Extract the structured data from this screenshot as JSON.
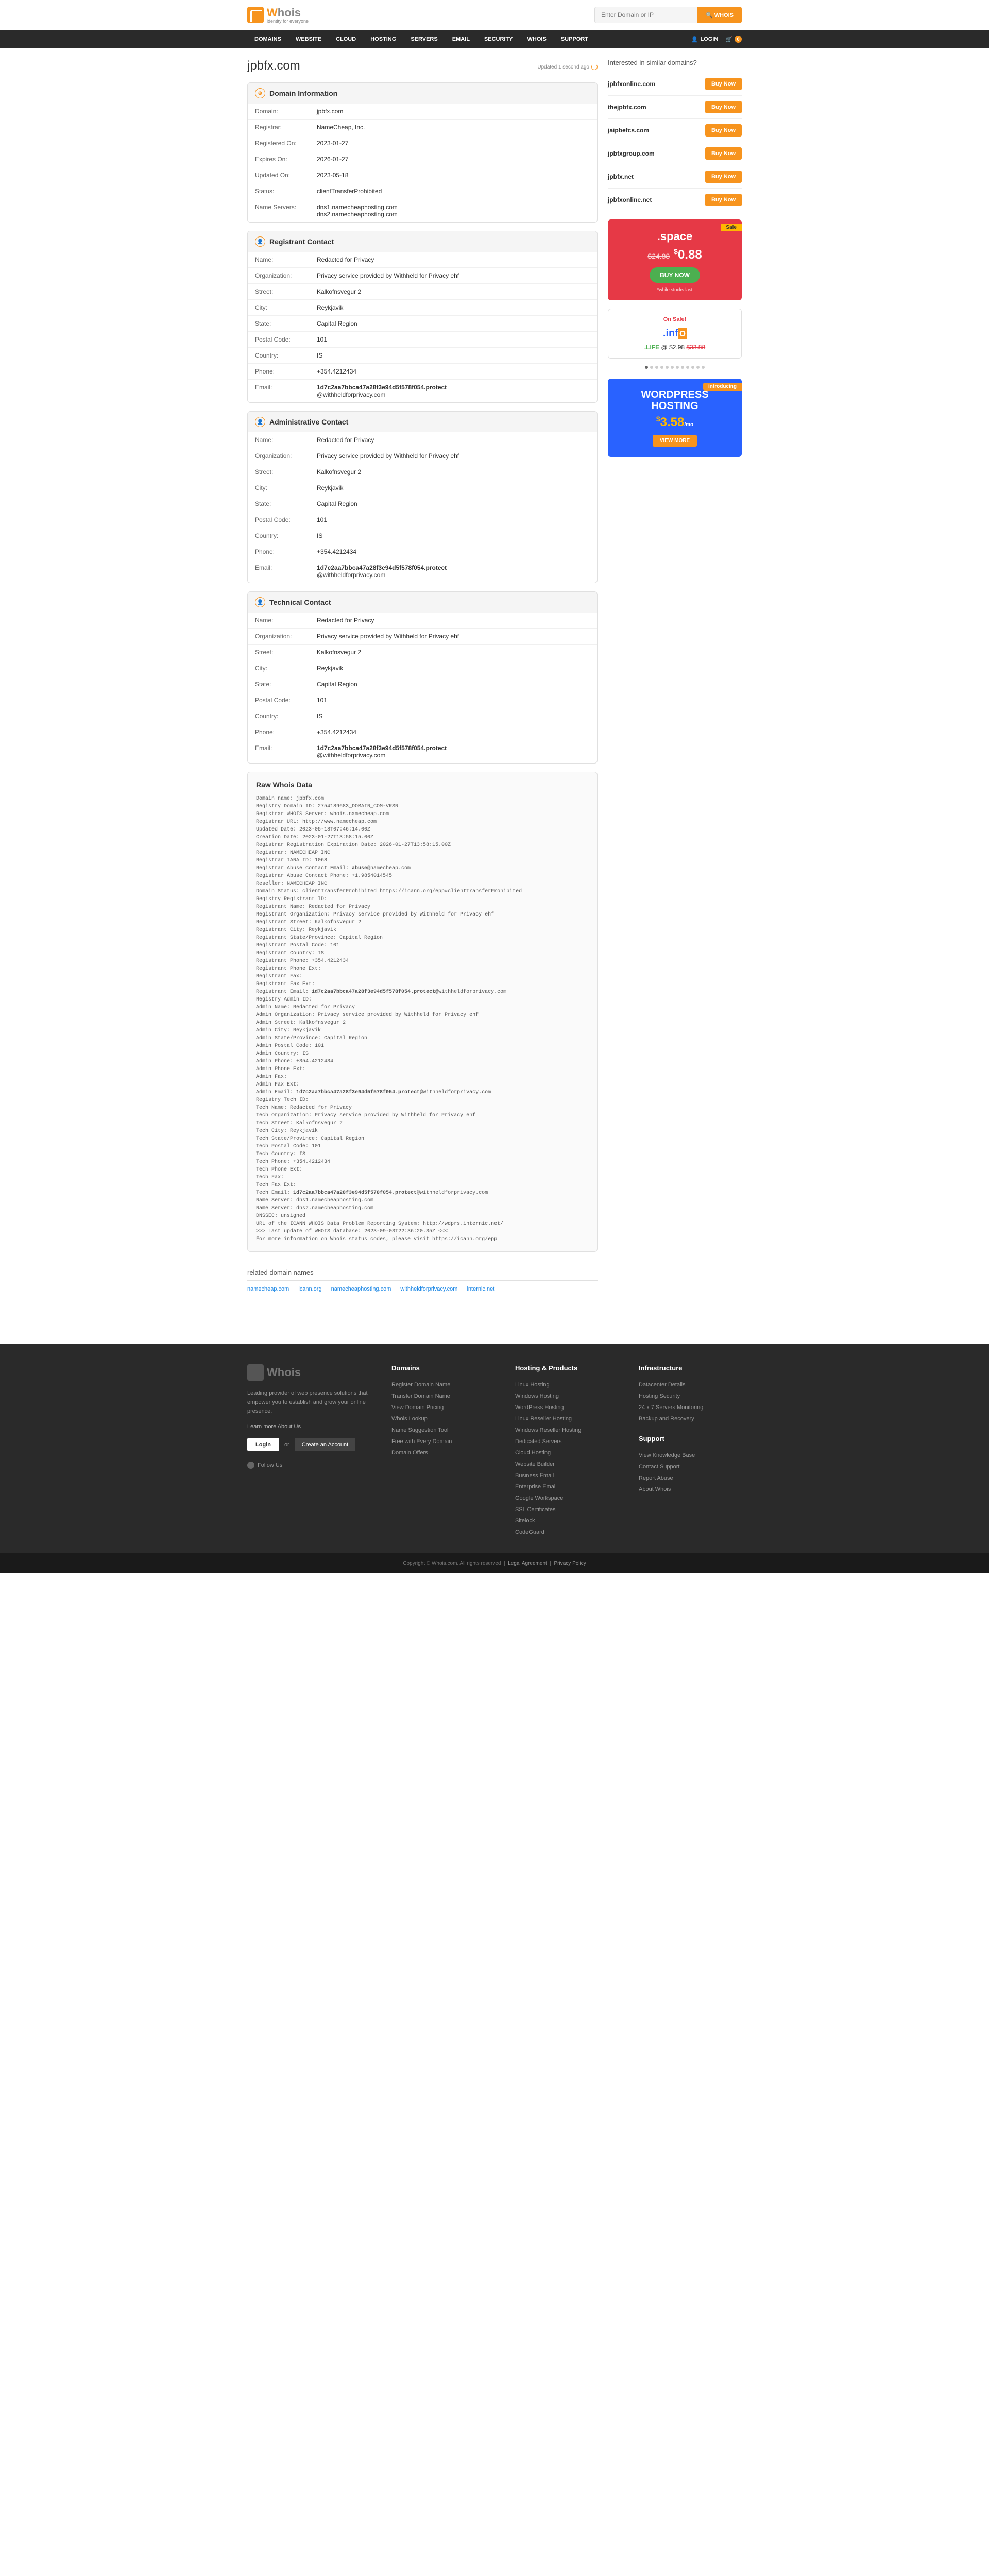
{
  "header": {
    "tagline": "identity for everyone",
    "search_placeholder": "Enter Domain or IP",
    "search_button": "WHOIS"
  },
  "nav": {
    "items": [
      "DOMAINS",
      "WEBSITE",
      "CLOUD",
      "HOSTING",
      "SERVERS",
      "EMAIL",
      "SECURITY",
      "WHOIS",
      "SUPPORT"
    ],
    "login": "LOGIN",
    "cart_count": "0"
  },
  "page": {
    "domain_title": "jpbfx.com",
    "updated_text": "Updated 1 second ago"
  },
  "domain_info": {
    "heading": "Domain Information",
    "rows": [
      {
        "label": "Domain:",
        "value": "jpbfx.com"
      },
      {
        "label": "Registrar:",
        "value": "NameCheap, Inc."
      },
      {
        "label": "Registered On:",
        "value": "2023-01-27"
      },
      {
        "label": "Expires On:",
        "value": "2026-01-27"
      },
      {
        "label": "Updated On:",
        "value": "2023-05-18"
      },
      {
        "label": "Status:",
        "value": "clientTransferProhibited"
      },
      {
        "label": "Name Servers:",
        "value": "dns1.namecheaphosting.com\ndns2.namecheaphosting.com"
      }
    ]
  },
  "registrant": {
    "heading": "Registrant Contact",
    "rows": [
      {
        "label": "Name:",
        "value": "Redacted for Privacy"
      },
      {
        "label": "Organization:",
        "value": "Privacy service provided by Withheld for Privacy ehf"
      },
      {
        "label": "Street:",
        "value": "Kalkofnsvegur 2"
      },
      {
        "label": "City:",
        "value": "Reykjavik"
      },
      {
        "label": "State:",
        "value": "Capital Region"
      },
      {
        "label": "Postal Code:",
        "value": "101"
      },
      {
        "label": "Country:",
        "value": "IS"
      },
      {
        "label": "Phone:",
        "value": "+354.4212434"
      },
      {
        "label": "Email:",
        "value_bold": "1d7c2aa7bbca47a28f3e94d5f578f054.protect",
        "value_rest": "@withheldforprivacy.com"
      }
    ]
  },
  "admin": {
    "heading": "Administrative Contact",
    "rows": [
      {
        "label": "Name:",
        "value": "Redacted for Privacy"
      },
      {
        "label": "Organization:",
        "value": "Privacy service provided by Withheld for Privacy ehf"
      },
      {
        "label": "Street:",
        "value": "Kalkofnsvegur 2"
      },
      {
        "label": "City:",
        "value": "Reykjavik"
      },
      {
        "label": "State:",
        "value": "Capital Region"
      },
      {
        "label": "Postal Code:",
        "value": "101"
      },
      {
        "label": "Country:",
        "value": "IS"
      },
      {
        "label": "Phone:",
        "value": "+354.4212434"
      },
      {
        "label": "Email:",
        "value_bold": "1d7c2aa7bbca47a28f3e94d5f578f054.protect",
        "value_rest": "@withheldforprivacy.com"
      }
    ]
  },
  "tech": {
    "heading": "Technical Contact",
    "rows": [
      {
        "label": "Name:",
        "value": "Redacted for Privacy"
      },
      {
        "label": "Organization:",
        "value": "Privacy service provided by Withheld for Privacy ehf"
      },
      {
        "label": "Street:",
        "value": "Kalkofnsvegur 2"
      },
      {
        "label": "City:",
        "value": "Reykjavik"
      },
      {
        "label": "State:",
        "value": "Capital Region"
      },
      {
        "label": "Postal Code:",
        "value": "101"
      },
      {
        "label": "Country:",
        "value": "IS"
      },
      {
        "label": "Phone:",
        "value": "+354.4212434"
      },
      {
        "label": "Email:",
        "value_bold": "1d7c2aa7bbca47a28f3e94d5f578f054.protect",
        "value_rest": "@withheldforprivacy.com"
      }
    ]
  },
  "raw": {
    "heading": "Raw Whois Data",
    "text": "Domain name: jpbfx.com\nRegistry Domain ID: 2754189683_DOMAIN_COM-VRSN\nRegistrar WHOIS Server: whois.namecheap.com\nRegistrar URL: http://www.namecheap.com\nUpdated Date: 2023-05-18T07:46:14.00Z\nCreation Date: 2023-01-27T13:58:15.00Z\nRegistrar Registration Expiration Date: 2026-01-27T13:58:15.00Z\nRegistrar: NAMECHEAP INC\nRegistrar IANA ID: 1068\nRegistrar Abuse Contact Email: abuse@namecheap.com\nRegistrar Abuse Contact Phone: +1.9854014545\nReseller: NAMECHEAP INC\nDomain Status: clientTransferProhibited https://icann.org/epp#clientTransferProhibited\nRegistry Registrant ID:\nRegistrant Name: Redacted for Privacy\nRegistrant Organization: Privacy service provided by Withheld for Privacy ehf\nRegistrant Street: Kalkofnsvegur 2\nRegistrant City: Reykjavik\nRegistrant State/Province: Capital Region\nRegistrant Postal Code: 101\nRegistrant Country: IS\nRegistrant Phone: +354.4212434\nRegistrant Phone Ext:\nRegistrant Fax:\nRegistrant Fax Ext:\nRegistrant Email: 1d7c2aa7bbca47a28f3e94d5f578f054.protect@withheldforprivacy.com\nRegistry Admin ID:\nAdmin Name: Redacted for Privacy\nAdmin Organization: Privacy service provided by Withheld for Privacy ehf\nAdmin Street: Kalkofnsvegur 2\nAdmin City: Reykjavik\nAdmin State/Province: Capital Region\nAdmin Postal Code: 101\nAdmin Country: IS\nAdmin Phone: +354.4212434\nAdmin Phone Ext:\nAdmin Fax:\nAdmin Fax Ext:\nAdmin Email: 1d7c2aa7bbca47a28f3e94d5f578f054.protect@withheldforprivacy.com\nRegistry Tech ID:\nTech Name: Redacted for Privacy\nTech Organization: Privacy service provided by Withheld for Privacy ehf\nTech Street: Kalkofnsvegur 2\nTech City: Reykjavik\nTech State/Province: Capital Region\nTech Postal Code: 101\nTech Country: IS\nTech Phone: +354.4212434\nTech Phone Ext:\nTech Fax:\nTech Fax Ext:\nTech Email: 1d7c2aa7bbca47a28f3e94d5f578f054.protect@withheldforprivacy.com\nName Server: dns1.namecheaphosting.com\nName Server: dns2.namecheaphosting.com\nDNSSEC: unsigned\nURL of the ICANN WHOIS Data Problem Reporting System: http://wdprs.internic.net/\n>>> Last update of WHOIS database: 2023-09-03T22:36:20.35Z <<<\nFor more information on Whois status codes, please visit https://icann.org/epp"
  },
  "related": {
    "heading": "related domain names",
    "links": [
      "namecheap.com",
      "icann.org",
      "namecheaphosting.com",
      "withheldforprivacy.com",
      "internic.net"
    ]
  },
  "sidebar": {
    "similar_heading": "Interested in similar domains?",
    "buy_label": "Buy Now",
    "similar": [
      "jpbfxonline.com",
      "thejpbfx.com",
      "jaipbefcs.com",
      "jpbfxgroup.com",
      "jpbfx.net",
      "jpbfxonline.net"
    ],
    "promo_space": {
      "badge": "Sale",
      "tld": ".space",
      "old": "$24.88",
      "new_cur": "$",
      "new": "0.88",
      "buy": "BUY NOW",
      "note": "*while stocks last"
    },
    "promo_info": {
      "onsale": "On Sale!",
      "logo": ".info",
      "line_tld": ".LIFE",
      "line_at": "@",
      "line_price": "$2.98",
      "line_old": "$33.88"
    },
    "promo_wp": {
      "badge": "introducing",
      "title1": "WORDPRESS",
      "title2": "HOSTING",
      "cur": "$",
      "price": "3.58",
      "mo": "/mo",
      "btn": "VIEW MORE"
    }
  },
  "footer": {
    "desc": "Leading provider of web presence solutions that empower you to establish and grow your online presence.",
    "learn": "Learn more About Us",
    "login": "Login",
    "or": "or",
    "create": "Create an Account",
    "follow": "Follow Us",
    "cols": [
      {
        "heading": "Domains",
        "links": [
          "Register Domain Name",
          "Transfer Domain Name",
          "View Domain Pricing",
          "Whois Lookup",
          "Name Suggestion Tool",
          "Free with Every Domain",
          "Domain Offers"
        ]
      },
      {
        "heading": "Hosting & Products",
        "links": [
          "Linux Hosting",
          "Windows Hosting",
          "WordPress Hosting",
          "Linux Reseller Hosting",
          "Windows Reseller Hosting",
          "Dedicated Servers",
          "Cloud Hosting",
          "Website Builder",
          "Business Email",
          "Enterprise Email",
          "Google Workspace",
          "SSL Certificates",
          "Sitelock",
          "CodeGuard"
        ]
      },
      {
        "heading": "Infrastructure",
        "links": [
          "Datacenter Details",
          "Hosting Security",
          "24 x 7 Servers Monitoring",
          "Backup and Recovery"
        ],
        "heading2": "Support",
        "links2": [
          "View Knowledge Base",
          "Contact Support",
          "Report Abuse",
          "About Whois"
        ]
      }
    ],
    "copyright": "Copyright © Whois.com. All rights reserved",
    "legal": "Legal Agreement",
    "privacy": "Privacy Policy"
  }
}
